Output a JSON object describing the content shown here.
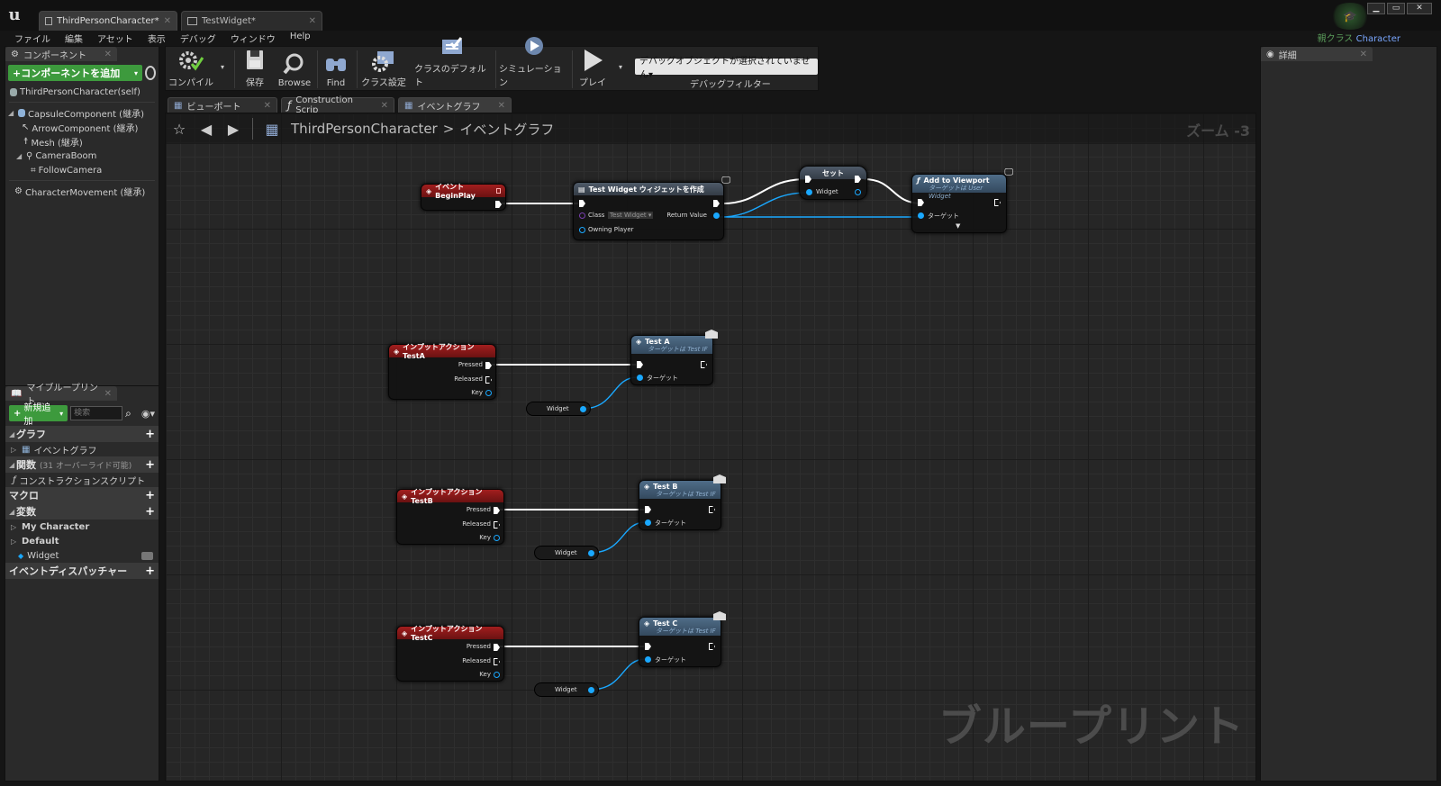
{
  "titlebar": {
    "tabs": [
      "ThirdPersonCharacter*",
      "TestWidget*"
    ],
    "parent_class_label": "親クラス",
    "parent_class_value": "Character"
  },
  "menubar": [
    "ファイル",
    "編集",
    "アセット",
    "表示",
    "デバッグ",
    "ウィンドウ",
    "Help"
  ],
  "components": {
    "tab_label": "コンポーネント",
    "add_button": "+コンポーネントを追加",
    "self": "ThirdPersonCharacter(self)",
    "items": [
      "CapsuleComponent (継承)",
      "ArrowComponent (継承)",
      "Mesh (継承)",
      "CameraBoom",
      "FollowCamera",
      "CharacterMovement (継承)"
    ]
  },
  "my_blueprint": {
    "tab_label": "マイブループリント",
    "add_new": "新規追加",
    "search_placeholder": "検索",
    "graph_section": "グラフ",
    "event_graph": "イベントグラフ",
    "functions_section": "関数",
    "functions_overridable": "(31 オーバーライド可能)",
    "construction_script": "コンストラクションスクリプト",
    "macros_section": "マクロ",
    "variables_section": "変数",
    "var_category_1": "My Character",
    "var_category_2": "Default",
    "var_widget": "Widget",
    "dispatchers_section": "イベントディスパッチャー"
  },
  "toolbar": {
    "compile": "コンパイル",
    "save": "保存",
    "browse": "Browse",
    "find": "Find",
    "class_settings": "クラス設定",
    "class_defaults": "クラスのデフォルト",
    "simulation": "シミュレーション",
    "play": "プレイ",
    "debug_object": "デバッグオブジェクトが選択されていません▾",
    "debug_filter": "デバッグフィルター"
  },
  "editor_tabs": [
    "ビューポート",
    "Construction Scrip",
    "イベントグラフ"
  ],
  "graph": {
    "breadcrumb_root": "ThirdPersonCharacter",
    "breadcrumb_sep": ">",
    "breadcrumb_leaf": "イベントグラフ",
    "zoom": "ズーム -3",
    "watermark": "ブループリント"
  },
  "nodes": {
    "begin_play": "イベント BeginPlay",
    "create_widget": "Test Widget ウィジェットを作成",
    "class_pin": "Class",
    "class_value": "Test Widget ▾",
    "owning_player": "Owning Player",
    "return_value": "Return Value",
    "set": "セット",
    "set_widget": "Widget",
    "add_to_viewport": "Add to Viewport",
    "add_to_viewport_sub": "ターゲットは User Widget",
    "target": "ターゲット",
    "input_a": "インプットアクション TestA",
    "input_b": "インプットアクション TestB",
    "input_c": "インプットアクション TestC",
    "pressed": "Pressed",
    "released": "Released",
    "key": "Key",
    "test_a": "Test A",
    "test_b": "Test B",
    "test_c": "Test C",
    "test_if_sub": "ターゲットは Test IF",
    "widget_var": "Widget"
  },
  "details": {
    "tab_label": "詳細"
  }
}
